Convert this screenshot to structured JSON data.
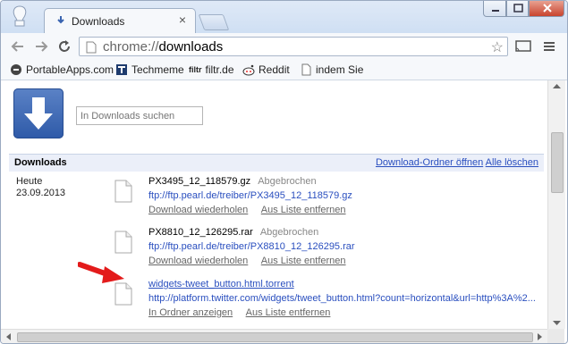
{
  "tab": {
    "title": "Downloads",
    "close": "×"
  },
  "omnibox": {
    "scheme": "chrome://",
    "path": "downloads"
  },
  "bookmarks": [
    {
      "label": "PortableApps.com"
    },
    {
      "label": "Techmeme"
    },
    {
      "label": "filtr.de",
      "icon_text": "filtr"
    },
    {
      "label": "Reddit"
    },
    {
      "label": "indem Sie"
    }
  ],
  "search": {
    "placeholder": "In Downloads suchen"
  },
  "header": {
    "title": "Downloads",
    "open_folder": "Download-Ordner öffnen",
    "clear_all": "Alle löschen"
  },
  "date": {
    "day": "Heute",
    "date": "23.09.2013"
  },
  "downloads": [
    {
      "name": "PX3495_12_118579.gz",
      "status": "Abgebrochen",
      "url": "ftp://ftp.pearl.de/treiber/PX3495_12_118579.gz",
      "action1": "Download wiederholen",
      "action2": "Aus Liste entfernen"
    },
    {
      "name": "PX8810_12_126295.rar",
      "status": "Abgebrochen",
      "url": "ftp://ftp.pearl.de/treiber/PX8810_12_126295.rar",
      "action1": "Download wiederholen",
      "action2": "Aus Liste entfernen"
    },
    {
      "name": "widgets-tweet_button.html.torrent",
      "status": "",
      "url": "http://platform.twitter.com/widgets/tweet_button.html?count=horizontal&url=http%3A%2...",
      "action1": "In Ordner anzeigen",
      "action2": "Aus Liste entfernen"
    }
  ],
  "colors": {
    "link": "#2a4fbf",
    "header_bg": "#ebeff9",
    "annotation_arrow": "#e31b1b",
    "big_icon": "#3a64b0"
  }
}
